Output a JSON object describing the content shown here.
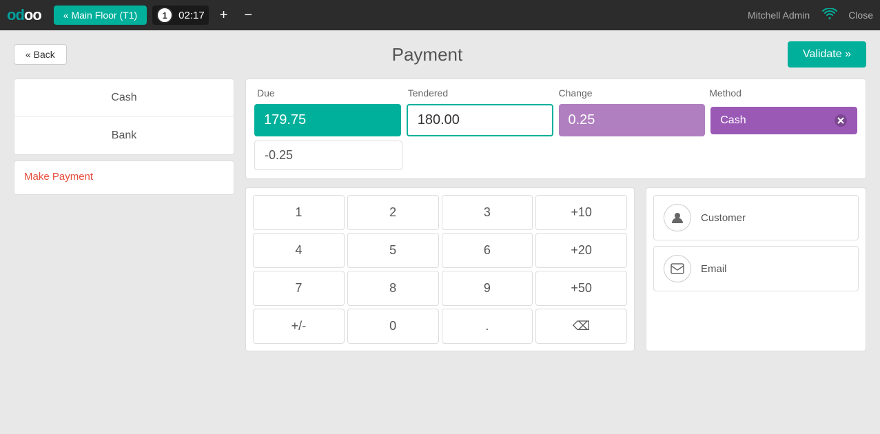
{
  "topbar": {
    "logo": "odoo",
    "main_floor_label": "« Main Floor (T1)",
    "order_number": "1",
    "timer": "02:17",
    "add_icon": "+",
    "minus_icon": "−",
    "user": "Mitchell Admin",
    "close_label": "Close"
  },
  "header": {
    "back_label": "« Back",
    "title": "Payment",
    "validate_label": "Validate »"
  },
  "payment_methods": {
    "items": [
      {
        "label": "Cash"
      },
      {
        "label": "Bank"
      }
    ]
  },
  "make_payment": {
    "label": "Make Payment"
  },
  "payment_table": {
    "columns": [
      "Due",
      "Tendered",
      "Change",
      "Method"
    ],
    "due": "179.75",
    "tendered": "180.00",
    "change": "0.25",
    "method": "Cash",
    "remaining": "-0.25"
  },
  "numpad": {
    "buttons": [
      "1",
      "2",
      "3",
      "+10",
      "4",
      "5",
      "6",
      "+20",
      "7",
      "8",
      "9",
      "+50",
      "+/-",
      "0",
      ".",
      "⌫"
    ]
  },
  "actions": {
    "customer_label": "Customer",
    "email_label": "Email",
    "customer_icon": "👤",
    "email_icon": "✉"
  }
}
